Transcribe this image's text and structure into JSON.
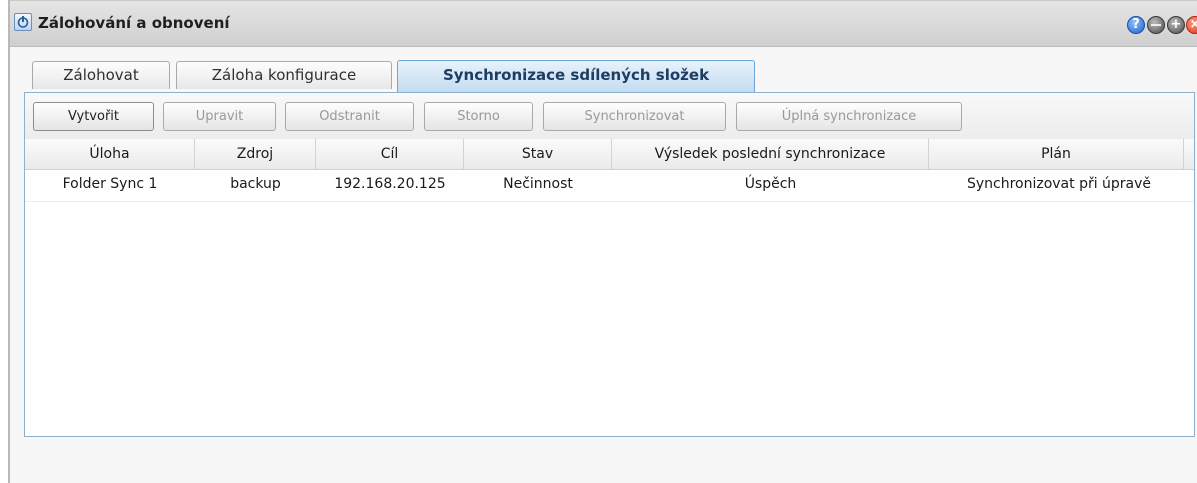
{
  "window": {
    "title": "Zálohování a obnovení",
    "controls": [
      "help-icon",
      "minimize-icon",
      "maximize-icon",
      "close-icon"
    ]
  },
  "tabs": [
    {
      "label": "Zálohovat",
      "active": false
    },
    {
      "label": "Záloha konfigurace",
      "active": false
    },
    {
      "label": "Synchronizace sdílených složek",
      "active": true
    }
  ],
  "toolbar": {
    "create": "Vytvořit",
    "edit": "Upravit",
    "delete": "Odstranit",
    "cancel": "Storno",
    "sync": "Synchronizovat",
    "full_sync": "Úplná synchronizace"
  },
  "table": {
    "columns": [
      "Úloha",
      "Zdroj",
      "Cíl",
      "Stav",
      "Výsledek poslední synchronizace",
      "Plán"
    ],
    "rows": [
      [
        "Folder Sync 1",
        "backup",
        "192.168.20.125",
        "Nečinnost",
        "Úspěch",
        "Synchronizovat při úpravě"
      ]
    ]
  },
  "colors": {
    "active_tab_bg": "#c2dbf1",
    "panel_border": "#8fb0cd",
    "close_button": "#d6361a",
    "help_button": "#1e63c9"
  }
}
